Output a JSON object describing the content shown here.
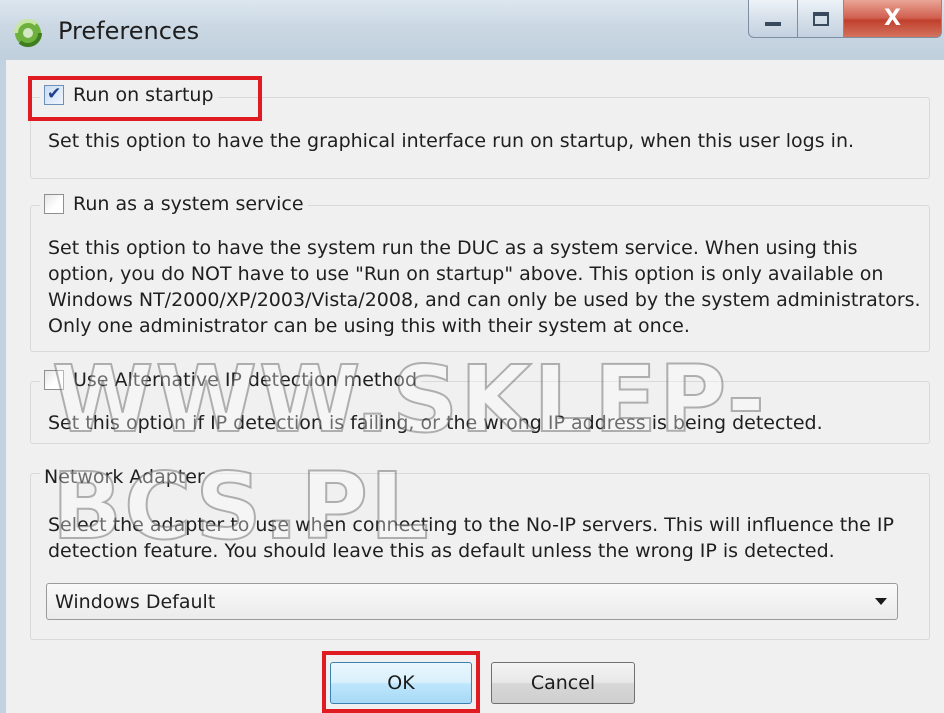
{
  "window": {
    "title": "Preferences",
    "close_glyph": "X",
    "controls": [
      "minimize-icon",
      "maximize-icon",
      "close-icon"
    ]
  },
  "options": {
    "run_on_startup": {
      "label": "Run on startup",
      "checked": true,
      "description": "Set this option to have the graphical interface run on startup, when this user logs in."
    },
    "system_service": {
      "label": "Run as a system service",
      "checked": false,
      "description": "Set this option to have the system run the DUC as a system service.  When using this option, you do NOT have to use \"Run on startup\" above.  This option is only available on Windows NT/2000/XP/2003/Vista/2008, and can only be used by the system administrators.  Only one administrator can be using this with their system at once."
    },
    "alt_ip": {
      "label": "Use Alternative IP detection method",
      "checked": false,
      "description": "Set this option if IP detection is failing, or the wrong IP address is being detected."
    }
  },
  "network_adapter": {
    "legend": "Network Adapter",
    "description": "Select the adapter to use when connecting to the No-IP servers.  This will influence the IP detection feature.  You should leave this as default unless the wrong IP is detected.",
    "selected": "Windows Default"
  },
  "buttons": {
    "ok": "OK",
    "cancel": "Cancel"
  },
  "watermark": "WWW.SKLEP-BCS.PL",
  "colors": {
    "highlight": "#e11b22",
    "ok_button": "#bee6fd",
    "close_button": "#c0402d"
  }
}
